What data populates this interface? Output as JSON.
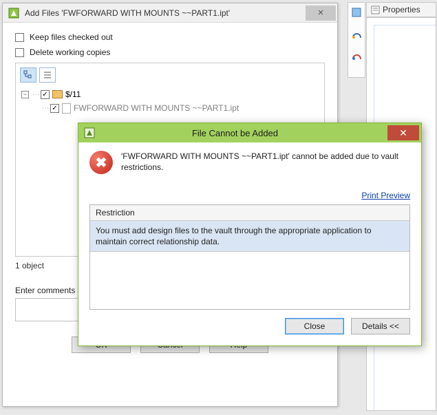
{
  "add_files": {
    "title": "Add Files 'FWFORWARD WITH MOUNTS ~~PART1.ipt'",
    "keep_checked_out": "Keep files checked out",
    "delete_working": "Delete working copies",
    "tree": {
      "root_label": "$/11",
      "child_label": "FWFORWARD WITH MOUNTS ~~PART1.ipt"
    },
    "object_count": "1 object",
    "comments_label": "Enter comments to",
    "buttons": {
      "ok": "OK",
      "cancel": "Cancel",
      "help": "Help"
    }
  },
  "properties": {
    "tab_label": "Properties"
  },
  "error_dialog": {
    "title": "File Cannot be Added",
    "message": "'FWFORWARD WITH MOUNTS ~~PART1.ipt' cannot be added due to vault restrictions.",
    "print_preview": "Print Preview",
    "table": {
      "header": "Restriction",
      "row": "You must add design files to the vault through the appropriate application to maintain correct relationship data."
    },
    "buttons": {
      "close": "Close",
      "details": "Details <<"
    }
  }
}
